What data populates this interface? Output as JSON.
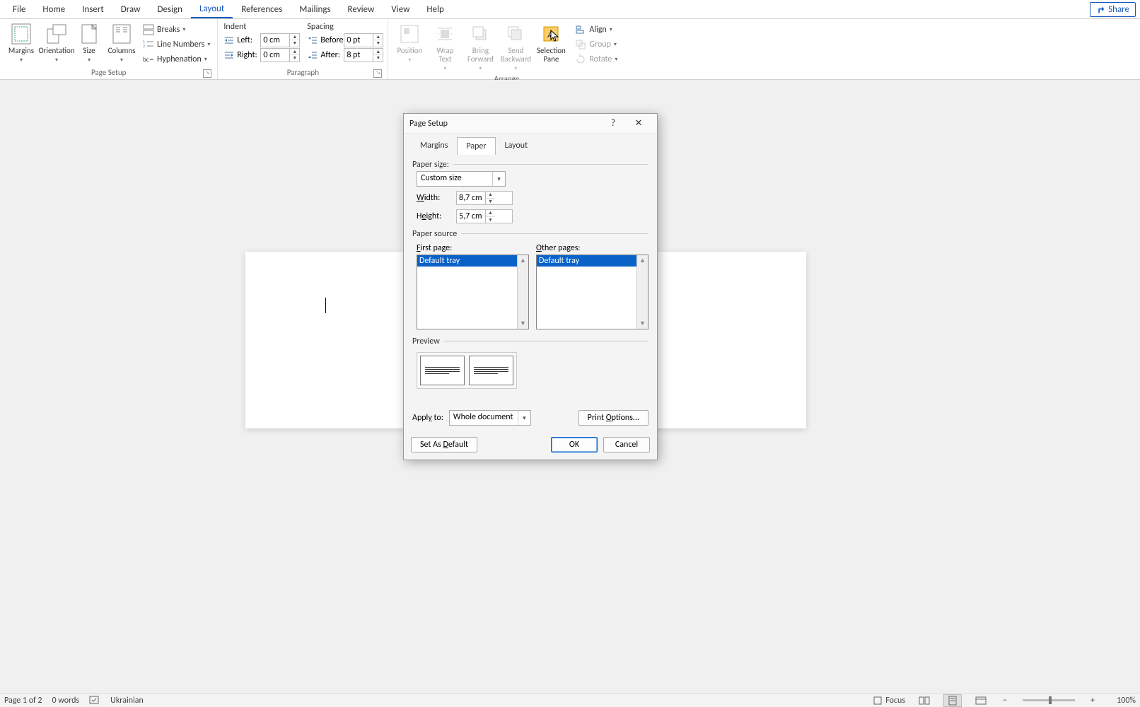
{
  "tabs": [
    "File",
    "Home",
    "Insert",
    "Draw",
    "Design",
    "Layout",
    "References",
    "Mailings",
    "Review",
    "View",
    "Help"
  ],
  "active_tab_index": 5,
  "share_label": "Share",
  "ribbon": {
    "page_setup": {
      "label": "Page Setup",
      "margins": "Margins",
      "orientation": "Orientation",
      "size": "Size",
      "columns": "Columns",
      "breaks": "Breaks",
      "line_numbers": "Line Numbers",
      "hyphenation": "Hyphenation"
    },
    "paragraph": {
      "label": "Paragraph",
      "indent": "Indent",
      "spacing": "Spacing",
      "left_label": "Left:",
      "right_label": "Right:",
      "before_label": "Before:",
      "after_label": "After:",
      "left_val": "0 cm",
      "right_val": "0 cm",
      "before_val": "0 pt",
      "after_val": "8 pt"
    },
    "arrange": {
      "label": "Arrange",
      "position": "Position",
      "wrap_text": "Wrap Text",
      "bring_forward": "Bring Forward",
      "send_backward": "Send Backward",
      "selection_pane": "Selection Pane",
      "align": "Align",
      "group": "Group",
      "rotate": "Rotate"
    }
  },
  "dialog": {
    "title": "Page Setup",
    "tabs": [
      "Margins",
      "Paper",
      "Layout"
    ],
    "active_tab_index": 1,
    "paper_size_label": "Paper size:",
    "paper_size_value": "Custom size",
    "width_label": "Width:",
    "width_value": "8,7 cm",
    "height_label": "Height:",
    "height_value": "5,7 cm",
    "paper_source_label": "Paper source",
    "first_page_label": "First page:",
    "other_pages_label": "Other pages:",
    "first_page_item": "Default tray",
    "other_pages_item": "Default tray",
    "preview_label": "Preview",
    "apply_to_label": "Apply to:",
    "apply_to_value": "Whole document",
    "print_options": "Print Options...",
    "set_as_default": "Set As Default",
    "ok": "OK",
    "cancel": "Cancel"
  },
  "status": {
    "page": "Page 1 of 2",
    "words": "0 words",
    "language": "Ukrainian",
    "focus": "Focus",
    "zoom": "100%"
  }
}
